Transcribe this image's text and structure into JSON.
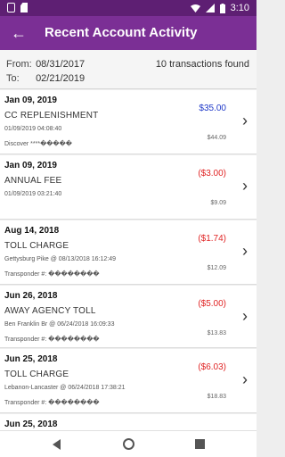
{
  "status": {
    "time": "3:10"
  },
  "appbar": {
    "title": "Recent Account Activity"
  },
  "filter": {
    "from_label": "From:",
    "from_value": "08/31/2017",
    "to_label": "To:",
    "to_value": "02/21/2019",
    "found": "10 transactions found"
  },
  "transactions": [
    {
      "date": "Jan 09, 2019",
      "description": "CC REPLENISHMENT",
      "detail": "01/09/2019 04:08:40",
      "extra": "Discover ****�����",
      "amount": "$35.00",
      "amount_kind": "pos",
      "balance": "$44.09"
    },
    {
      "date": "Jan 09, 2019",
      "description": "ANNUAL FEE",
      "detail": "01/09/2019 03:21:40",
      "extra": "",
      "amount": "($3.00)",
      "amount_kind": "neg",
      "balance": "$9.09"
    },
    {
      "date": "Aug 14, 2018",
      "description": "TOLL CHARGE",
      "detail": "Gettysburg Pike @ 08/13/2018 16:12:49",
      "extra": "Transponder #: ��������",
      "amount": "($1.74)",
      "amount_kind": "neg",
      "balance": "$12.09"
    },
    {
      "date": "Jun 26, 2018",
      "description": "AWAY AGENCY TOLL",
      "detail": "Ben Franklin Br @ 06/24/2018 16:09:33",
      "extra": "Transponder #: ��������",
      "amount": "($5.00)",
      "amount_kind": "neg",
      "balance": "$13.83"
    },
    {
      "date": "Jun 25, 2018",
      "description": "TOLL CHARGE",
      "detail": "Lebanon-Lancaster @ 06/24/2018 17:38:21",
      "extra": "Transponder #: ��������",
      "amount": "($6.03)",
      "amount_kind": "neg",
      "balance": "$18.83"
    },
    {
      "date": "Jun 25, 2018",
      "description": "",
      "detail": "",
      "extra": "",
      "amount": "",
      "amount_kind": "neg",
      "balance": ""
    }
  ]
}
